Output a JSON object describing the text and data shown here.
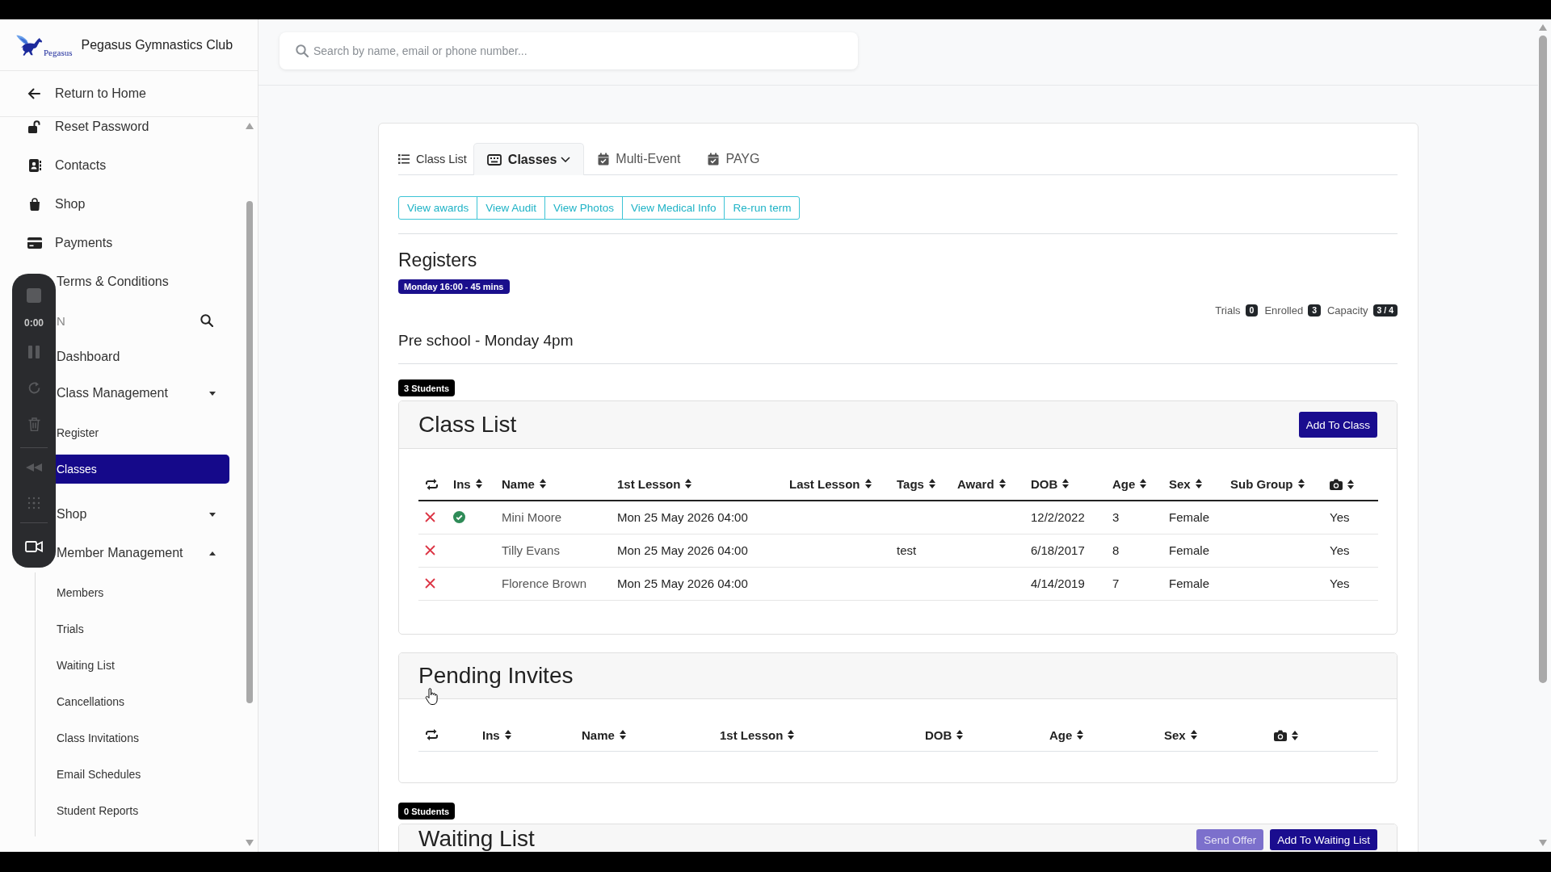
{
  "recorder": {
    "timer": "0:00"
  },
  "sidebar": {
    "logo_text": "Pegasus",
    "club_name": "Pegasus Gymnastics Club",
    "return_link": "Return to Home",
    "menu": [
      {
        "label": "Reset Password",
        "selected": false
      },
      {
        "label": "Contacts",
        "selected": false
      },
      {
        "label": "Shop",
        "selected": false
      },
      {
        "label": "Payments",
        "selected": false
      },
      {
        "label": "Terms & Conditions",
        "selected": false
      }
    ],
    "section": {
      "label": "N"
    },
    "nav": [
      {
        "label": "Dashboard",
        "kind": "link",
        "selected": false
      },
      {
        "label": "Class Management",
        "kind": "group",
        "expanded": false,
        "selected": false,
        "children": [
          {
            "label": "Register",
            "selected": false
          },
          {
            "label": "Classes",
            "selected": true
          }
        ]
      },
      {
        "label": "Shop",
        "kind": "group",
        "expanded": false,
        "selected": false
      },
      {
        "label": "Member Management",
        "kind": "group",
        "expanded": true,
        "selected": false,
        "children": [
          {
            "label": "Members",
            "selected": false
          },
          {
            "label": "Trials",
            "selected": false
          },
          {
            "label": "Waiting List",
            "selected": false
          },
          {
            "label": "Cancellations",
            "selected": false
          },
          {
            "label": "Class Invitations",
            "selected": false
          },
          {
            "label": "Email Schedules",
            "selected": false
          },
          {
            "label": "Student Reports",
            "selected": false
          }
        ]
      }
    ]
  },
  "search": {
    "placeholder": "Search by name, email or phone number..."
  },
  "tabs": [
    {
      "label": "Class List",
      "kind": "link",
      "selected": false
    },
    {
      "label": "Classes",
      "kind": "dropdown",
      "selected": true
    },
    {
      "label": "Multi-Event",
      "kind": "tab",
      "selected": false
    },
    {
      "label": "PAYG",
      "kind": "tab",
      "selected": false
    }
  ],
  "actions": [
    "View awards",
    "View Audit",
    "View Photos",
    "View Medical Info",
    "Re-run term"
  ],
  "register": {
    "title": "Registers",
    "schedule_badge": "Monday 16:00 - 45 mins",
    "stats": [
      {
        "label": "Trials",
        "value": "0"
      },
      {
        "label": "Enrolled",
        "value": "3"
      },
      {
        "label": "Capacity",
        "value": "3 / 4"
      }
    ],
    "class_name": "Pre school - Monday 4pm"
  },
  "class_list": {
    "count_badge": "3 Students",
    "title": "Class List",
    "add_button": "Add To Class",
    "columns": [
      {
        "kind": "icon",
        "sortable": false
      },
      {
        "kind": "text",
        "label": "Ins",
        "sortable": true
      },
      {
        "kind": "text",
        "label": "Name",
        "sortable": true
      },
      {
        "kind": "text",
        "label": "1st Lesson",
        "sortable": true
      },
      {
        "kind": "text",
        "label": "Last Lesson",
        "sortable": true
      },
      {
        "kind": "text",
        "label": "Tags",
        "sortable": true
      },
      {
        "kind": "text",
        "label": "Award",
        "sortable": true
      },
      {
        "kind": "text",
        "label": "DOB",
        "sortable": true
      },
      {
        "kind": "text",
        "label": "Age",
        "sortable": true
      },
      {
        "kind": "text",
        "label": "Sex",
        "sortable": true
      },
      {
        "kind": "text",
        "label": "Sub Group",
        "sortable": true
      },
      {
        "kind": "icon",
        "sortable": true
      }
    ],
    "rows": [
      {
        "ins": true,
        "name": "Mini Moore",
        "first_lesson": "Mon 25 May 2026 04:00",
        "dob": "12/2/2022",
        "age": "3",
        "sex": "Female",
        "camera": "Yes"
      },
      {
        "ins": false,
        "name": "Tilly Evans",
        "first_lesson": "Mon 25 May 2026 04:00",
        "tags": "test",
        "dob": "6/18/2017",
        "age": "8",
        "sex": "Female",
        "camera": "Yes"
      },
      {
        "ins": false,
        "name": "Florence Brown",
        "first_lesson": "Mon 25 May 2026 04:00",
        "dob": "4/14/2019",
        "age": "7",
        "sex": "Female",
        "camera": "Yes"
      }
    ]
  },
  "pending_invites": {
    "title": "Pending Invites",
    "columns": [
      {
        "kind": "icon",
        "sortable": false
      },
      {
        "kind": "text",
        "label": "Ins",
        "sortable": true
      },
      {
        "kind": "text",
        "label": "Name",
        "sortable": true
      },
      {
        "kind": "text",
        "label": "1st Lesson",
        "sortable": true
      },
      {
        "kind": "text",
        "label": "DOB",
        "sortable": true
      },
      {
        "kind": "text",
        "label": "Age",
        "sortable": true
      },
      {
        "kind": "text",
        "label": "Sex",
        "sortable": true
      },
      {
        "kind": "icon",
        "sortable": true
      }
    ]
  },
  "waiting_list": {
    "count_badge": "0 Students",
    "title": "Waiting List",
    "buttons": [
      {
        "label": "Send Offer",
        "disabled": true
      },
      {
        "label": "Add To Waiting List",
        "disabled": false
      }
    ]
  }
}
